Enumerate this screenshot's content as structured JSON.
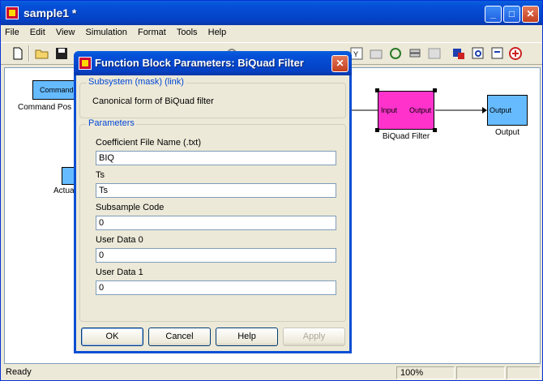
{
  "window": {
    "title": "sample1 *"
  },
  "menu": [
    "File",
    "Edit",
    "View",
    "Simulation",
    "Format",
    "Tools",
    "Help"
  ],
  "canvas": {
    "blocks": {
      "command_label": "Command Pos",
      "command_text": "Command",
      "actual_label": "Actua",
      "biquad_input": "Input",
      "biquad_output": "Output",
      "biquad_label": "BiQuad Filter",
      "output_port": "Output",
      "output_label": "Output"
    },
    "colors": {
      "biquad": "#ff33cc",
      "port": "#66bbff"
    }
  },
  "status": {
    "text": "Ready",
    "zoom": "100%"
  },
  "dialog": {
    "title": "Function Block Parameters: BiQuad Filter",
    "subsystem_legend": "Subsystem (mask) (link)",
    "description": "Canonical form of BiQuad filter",
    "params_legend": "Parameters",
    "fields": [
      {
        "label": "Coefficient File Name (.txt)",
        "value": "BIQ"
      },
      {
        "label": "Ts",
        "value": "Ts"
      },
      {
        "label": "Subsample Code",
        "value": "0"
      },
      {
        "label": "User Data 0",
        "value": "0"
      },
      {
        "label": "User Data 1",
        "value": "0"
      }
    ],
    "buttons": {
      "ok": "OK",
      "cancel": "Cancel",
      "help": "Help",
      "apply": "Apply"
    }
  }
}
